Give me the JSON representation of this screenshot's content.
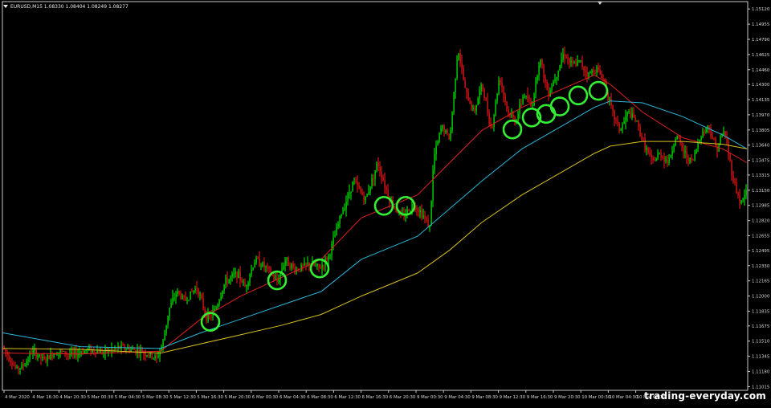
{
  "window": {
    "title": "EURUSD,M15  1.08330 1.08404 1.08249 1.08277",
    "watermark": "trading-everyday.com"
  },
  "colors": {
    "background": "#000000",
    "frame": "#c8c8c8",
    "bull": "#00ff00",
    "bear": "#ff1a1a",
    "ma_fast": "#e02020",
    "ma_mid": "#2ab8d8",
    "ma_slow": "#d8c020",
    "circle": "#33ee33",
    "text": "#d8d8d8"
  },
  "chart_data": {
    "type": "candlestick",
    "symbol": "EURUSD",
    "timeframe": "M15",
    "ohlc_header": {
      "open": 1.0833,
      "high": 1.08404,
      "low": 1.08249,
      "close": 1.08277
    },
    "ylim": [
      1.10975,
      1.152
    ],
    "y_ticks": [
      "1.15120",
      "1.14955",
      "1.14790",
      "1.14625",
      "1.14460",
      "1.14300",
      "1.14135",
      "1.13970",
      "1.13805",
      "1.13640",
      "1.13475",
      "1.13315",
      "1.13150",
      "1.12985",
      "1.12820",
      "1.12655",
      "1.12495",
      "1.12330",
      "1.12165",
      "1.12000",
      "1.11835",
      "1.11675",
      "1.11510",
      "1.11345",
      "1.11180",
      "1.11015"
    ],
    "x_ticks": [
      "4 Mar 2020",
      "4 Mar 16:30",
      "4 Mar 20:30",
      "5 Mar 00:30",
      "5 Mar 04:30",
      "5 Mar 08:30",
      "5 Mar 12:30",
      "5 Mar 16:30",
      "5 Mar 20:30",
      "6 Mar 00:30",
      "6 Mar 04:30",
      "6 Mar 08:30",
      "6 Mar 12:30",
      "6 Mar 16:30",
      "6 Mar 20:30",
      "9 Mar 00:30",
      "9 Mar 04:30",
      "9 Mar 08:30",
      "9 Mar 12:30",
      "9 Mar 16:30",
      "9 Mar 20:30",
      "10 Mar 00:30",
      "10 Mar 04:30",
      "10 Mar 08:30"
    ],
    "price_path": [
      [
        0,
        1.115
      ],
      [
        10,
        1.1135
      ],
      [
        20,
        1.112
      ],
      [
        30,
        1.1125
      ],
      [
        40,
        1.114
      ],
      [
        55,
        1.113
      ],
      [
        70,
        1.114
      ],
      [
        90,
        1.1136
      ],
      [
        110,
        1.1142
      ],
      [
        130,
        1.1139
      ],
      [
        150,
        1.1144
      ],
      [
        175,
        1.114
      ],
      [
        195,
        1.1132
      ],
      [
        203,
        1.115
      ],
      [
        210,
        1.1185
      ],
      [
        220,
        1.1205
      ],
      [
        230,
        1.1195
      ],
      [
        245,
        1.121
      ],
      [
        258,
        1.1175
      ],
      [
        268,
        1.1185
      ],
      [
        280,
        1.1215
      ],
      [
        295,
        1.1225
      ],
      [
        305,
        1.121
      ],
      [
        318,
        1.124
      ],
      [
        332,
        1.123
      ],
      [
        345,
        1.1215
      ],
      [
        355,
        1.124
      ],
      [
        368,
        1.1228
      ],
      [
        385,
        1.1235
      ],
      [
        398,
        1.123
      ],
      [
        410,
        1.1245
      ],
      [
        425,
        1.129
      ],
      [
        440,
        1.1325
      ],
      [
        455,
        1.1305
      ],
      [
        470,
        1.1345
      ],
      [
        485,
        1.1305
      ],
      [
        500,
        1.1285
      ],
      [
        515,
        1.13
      ],
      [
        525,
        1.129
      ],
      [
        535,
        1.1275
      ],
      [
        540,
        1.135
      ],
      [
        550,
        1.1385
      ],
      [
        560,
        1.137
      ],
      [
        570,
        1.147
      ],
      [
        580,
        1.142
      ],
      [
        590,
        1.14
      ],
      [
        600,
        1.143
      ],
      [
        612,
        1.138
      ],
      [
        622,
        1.144
      ],
      [
        632,
        1.14
      ],
      [
        642,
        1.139
      ],
      [
        652,
        1.142
      ],
      [
        662,
        1.1405
      ],
      [
        672,
        1.146
      ],
      [
        682,
        1.142
      ],
      [
        692,
        1.144
      ],
      [
        702,
        1.1465
      ],
      [
        712,
        1.145
      ],
      [
        722,
        1.1455
      ],
      [
        732,
        1.144
      ],
      [
        742,
        1.1448
      ],
      [
        752,
        1.1435
      ],
      [
        762,
        1.14
      ],
      [
        772,
        1.138
      ],
      [
        782,
        1.14
      ],
      [
        792,
        1.139
      ],
      [
        802,
        1.1365
      ],
      [
        812,
        1.1345
      ],
      [
        822,
        1.1355
      ],
      [
        832,
        1.1345
      ],
      [
        842,
        1.1375
      ],
      [
        852,
        1.1355
      ],
      [
        862,
        1.1345
      ],
      [
        872,
        1.1375
      ],
      [
        882,
        1.1385
      ],
      [
        892,
        1.136
      ],
      [
        902,
        1.138
      ],
      [
        912,
        1.133
      ],
      [
        922,
        1.13
      ],
      [
        930,
        1.1315
      ]
    ],
    "moving_averages": [
      {
        "name": "",
        "color_key": "ma_fast",
        "points": [
          [
            0,
            1.1138
          ],
          [
            100,
            1.1137
          ],
          [
            200,
            1.114
          ],
          [
            250,
            1.1175
          ],
          [
            300,
            1.12
          ],
          [
            350,
            1.122
          ],
          [
            400,
            1.124
          ],
          [
            450,
            1.1285
          ],
          [
            520,
            1.131
          ],
          [
            560,
            1.1345
          ],
          [
            600,
            1.138
          ],
          [
            650,
            1.1405
          ],
          [
            700,
            1.1425
          ],
          [
            740,
            1.144
          ],
          [
            760,
            1.143
          ],
          [
            800,
            1.14
          ],
          [
            850,
            1.1372
          ],
          [
            900,
            1.136
          ],
          [
            930,
            1.1345
          ]
        ]
      },
      {
        "name": "",
        "color_key": "ma_mid",
        "points": [
          [
            0,
            1.116
          ],
          [
            100,
            1.1145
          ],
          [
            200,
            1.1143
          ],
          [
            250,
            1.116
          ],
          [
            300,
            1.1175
          ],
          [
            350,
            1.119
          ],
          [
            400,
            1.1205
          ],
          [
            450,
            1.124
          ],
          [
            520,
            1.1265
          ],
          [
            560,
            1.1295
          ],
          [
            600,
            1.1325
          ],
          [
            650,
            1.136
          ],
          [
            700,
            1.1385
          ],
          [
            740,
            1.1405
          ],
          [
            760,
            1.1412
          ],
          [
            800,
            1.141
          ],
          [
            850,
            1.1395
          ],
          [
            900,
            1.1375
          ],
          [
            930,
            1.136
          ]
        ]
      },
      {
        "name": "",
        "color_key": "ma_slow",
        "points": [
          [
            0,
            1.1143
          ],
          [
            100,
            1.1142
          ],
          [
            200,
            1.1138
          ],
          [
            250,
            1.1148
          ],
          [
            300,
            1.1158
          ],
          [
            350,
            1.1168
          ],
          [
            400,
            1.118
          ],
          [
            450,
            1.12
          ],
          [
            520,
            1.1225
          ],
          [
            560,
            1.125
          ],
          [
            600,
            1.128
          ],
          [
            650,
            1.131
          ],
          [
            700,
            1.1335
          ],
          [
            740,
            1.1355
          ],
          [
            760,
            1.1363
          ],
          [
            800,
            1.1368
          ],
          [
            850,
            1.1368
          ],
          [
            900,
            1.1365
          ],
          [
            930,
            1.136
          ]
        ]
      }
    ],
    "annotations": [
      {
        "type": "circle",
        "x": 262,
        "price": 1.1172
      },
      {
        "type": "circle",
        "x": 345,
        "price": 1.1217
      },
      {
        "type": "circle",
        "x": 398,
        "price": 1.123
      },
      {
        "type": "circle",
        "x": 478,
        "price": 1.1298
      },
      {
        "type": "circle",
        "x": 505,
        "price": 1.1298
      },
      {
        "type": "circle",
        "x": 638,
        "price": 1.1381
      },
      {
        "type": "circle",
        "x": 662,
        "price": 1.1394
      },
      {
        "type": "circle",
        "x": 680,
        "price": 1.1398
      },
      {
        "type": "circle",
        "x": 697,
        "price": 1.1406
      },
      {
        "type": "circle",
        "x": 720,
        "price": 1.1418
      },
      {
        "type": "circle",
        "x": 745,
        "price": 1.1423
      }
    ]
  }
}
